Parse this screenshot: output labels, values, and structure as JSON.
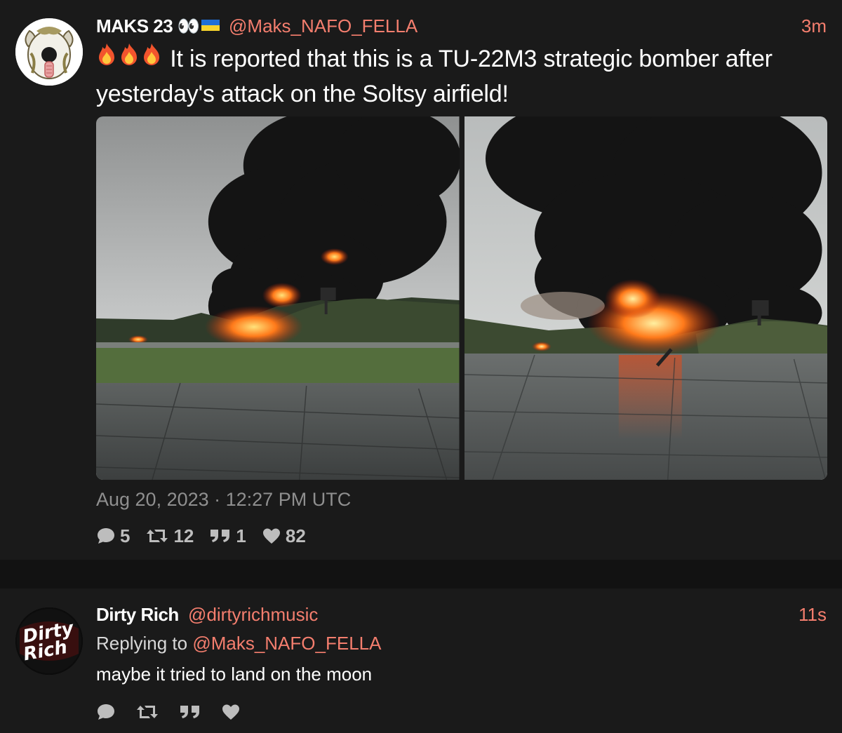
{
  "posts": [
    {
      "author": {
        "display_name": "MAKS 23 👀",
        "handle": "@Maks_NAFO_FELLA",
        "avatar_icon": "cartoon-dog-avatar"
      },
      "time": "3m",
      "text": "It is reported that this is a TU-22M3 strategic bomber after yesterday's attack on the Soltsy airfield!",
      "text_prefix_icons": [
        "fire-emoji",
        "fire-emoji",
        "fire-emoji"
      ],
      "media": [
        {
          "description_icon": "burning-airfield-photo"
        },
        {
          "description_icon": "burning-airfield-photo"
        }
      ],
      "date": "Aug 20, 2023 · 12:27 PM UTC",
      "stats": {
        "replies": "5",
        "reposts": "12",
        "quotes": "1",
        "likes": "82"
      }
    },
    {
      "author": {
        "display_name": "Dirty Rich",
        "handle": "@dirtyrichmusic",
        "avatar_text": "Dirty Rich"
      },
      "time": "11s",
      "replying_label": "Replying to",
      "replying_handle": "@Maks_NAFO_FELLA",
      "text": "maybe it tried to land on the moon"
    }
  ],
  "colors": {
    "background": "#1a1a1a",
    "separator": "#121212",
    "accent": "#f47e6e",
    "muted": "#8f8f8f",
    "icon": "#bdbdbd"
  }
}
